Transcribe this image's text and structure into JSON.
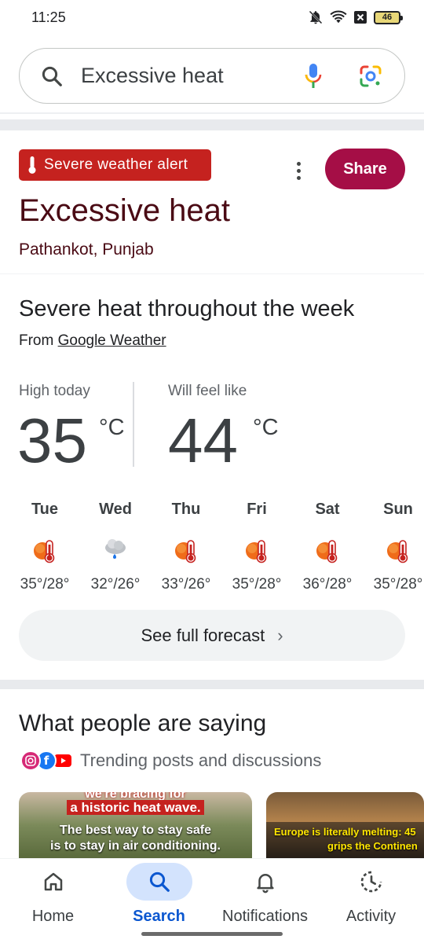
{
  "status_bar": {
    "time": "11:25",
    "battery": "46"
  },
  "search": {
    "query": "Excessive heat"
  },
  "alert": {
    "badge": "Severe weather alert",
    "title": "Excessive heat",
    "location": "Pathankot, Punjab",
    "share_label": "Share"
  },
  "weather": {
    "heading": "Severe heat throughout the week",
    "from_prefix": "From",
    "source": "Google Weather",
    "high_label": "High today",
    "high_value": "35",
    "feel_label": "Will feel like",
    "feel_value": "44",
    "unit": "°C",
    "forecast": [
      {
        "day": "Tue",
        "temps": "35°/28°",
        "icon": "hot-icon"
      },
      {
        "day": "Wed",
        "temps": "32°/26°",
        "icon": "rain-cloud-icon"
      },
      {
        "day": "Thu",
        "temps": "33°/26°",
        "icon": "hot-icon"
      },
      {
        "day": "Fri",
        "temps": "35°/28°",
        "icon": "hot-icon"
      },
      {
        "day": "Sat",
        "temps": "36°/28°",
        "icon": "hot-icon"
      },
      {
        "day": "Sun",
        "temps": "35°/28°",
        "icon": "hot-icon"
      }
    ],
    "full_forecast_label": "See full forecast"
  },
  "people": {
    "heading": "What people are saying",
    "subtitle": "Trending posts and discussions",
    "posts": [
      {
        "line1": "we're bracing for",
        "line2": "a historic heat wave.",
        "line3": "The best way to stay safe",
        "line4": "is to stay in air conditioning."
      },
      {
        "line1": "Europe is literally melting: 45",
        "line2": "grips the Continen"
      }
    ]
  },
  "nav": {
    "items": [
      {
        "label": "Home",
        "icon": "home-icon"
      },
      {
        "label": "Search",
        "icon": "search-icon"
      },
      {
        "label": "Notifications",
        "icon": "bell-icon"
      },
      {
        "label": "Activity",
        "icon": "activity-icon"
      }
    ],
    "active": "Search"
  },
  "colors": {
    "alert_red": "#c5221f",
    "share_maroon": "#a50e46",
    "title_maroon": "#4a0a14",
    "nav_active_blue": "#0b57d0",
    "nav_pill": "#d3e3fd"
  }
}
